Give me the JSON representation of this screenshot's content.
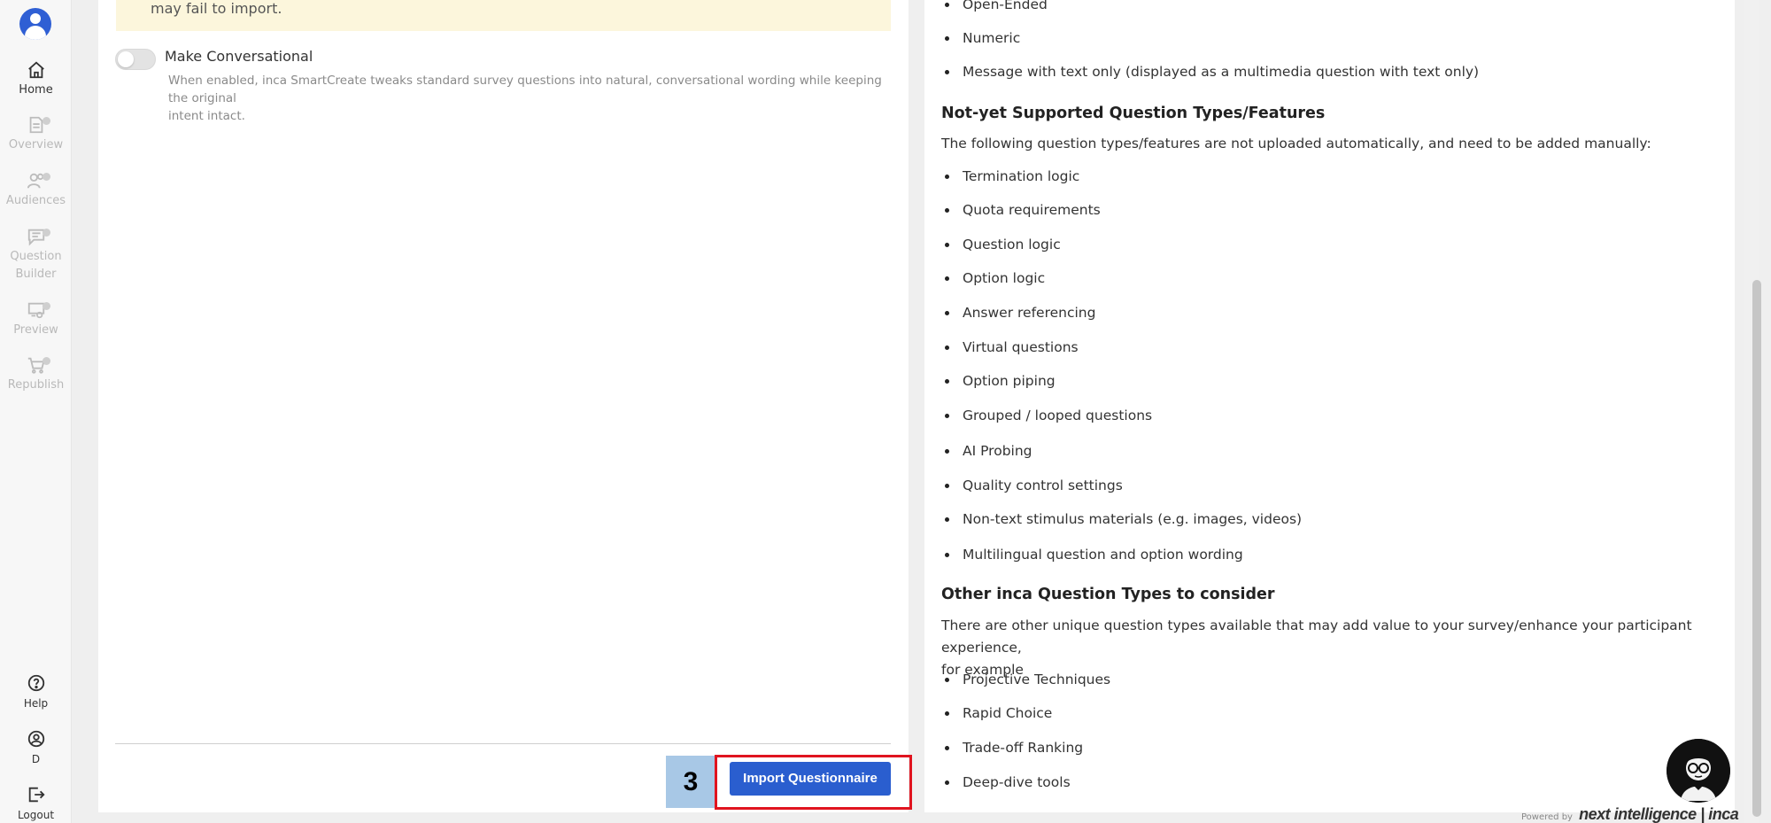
{
  "sidebar": {
    "items": [
      {
        "label": "Home",
        "icon": "home-icon",
        "active": true
      },
      {
        "label": "Overview",
        "icon": "document-icon"
      },
      {
        "label": "Audiences",
        "icon": "users-icon"
      },
      {
        "label_line1": "Question",
        "label_line2": "Builder",
        "icon": "chat-list-icon"
      },
      {
        "label": "Preview",
        "icon": "preview-icon"
      },
      {
        "label": "Republish",
        "icon": "cart-icon"
      }
    ],
    "bottom": [
      {
        "label": "Help",
        "icon": "help-icon"
      },
      {
        "label": "D",
        "icon": "user-circle-icon"
      },
      {
        "label": "Logout",
        "icon": "logout-icon"
      }
    ]
  },
  "left": {
    "warning_text": "may fail to import.",
    "toggle_label": "Make Conversational",
    "toggle_on": false,
    "toggle_desc_line1": "When enabled, inca SmartCreate tweaks standard survey questions into natural, conversational wording while keeping the original",
    "toggle_desc_line2": "intent intact.",
    "step_number": "3",
    "import_button": "Import Questionnaire"
  },
  "right": {
    "supported_tail": [
      "Open-Ended",
      "Numeric",
      "Message with text only (displayed as a multimedia question with text only)"
    ],
    "not_supported_heading": "Not-yet Supported Question Types/Features",
    "not_supported_intro": "The following question types/features are not uploaded automatically, and need to be added manually:",
    "not_supported_items": [
      "Termination logic",
      "Quota requirements",
      "Question logic",
      "Option logic",
      "Answer referencing",
      "Virtual questions",
      "Option piping",
      "Grouped / looped questions",
      "AI Probing",
      "Quality control settings",
      "Non-text stimulus materials (e.g. images, videos)",
      "Multilingual question and option wording"
    ],
    "other_heading": "Other inca Question Types to consider",
    "other_intro_line1": "There are other unique question types available that may add value to your survey/enhance your participant experience,",
    "other_intro_line2": "for example",
    "other_items": [
      "Projective Techniques",
      "Rapid Choice",
      "Trade-off Ranking",
      "Deep-dive tools"
    ]
  },
  "footer": {
    "powered_by": "Powered by",
    "brand": "next intelligence | inca"
  },
  "colors": {
    "accent": "#2a5ecf",
    "highlight": "#e0141f",
    "step_badge": "#a8c8e6",
    "warning_bg": "#fcf6dc"
  }
}
